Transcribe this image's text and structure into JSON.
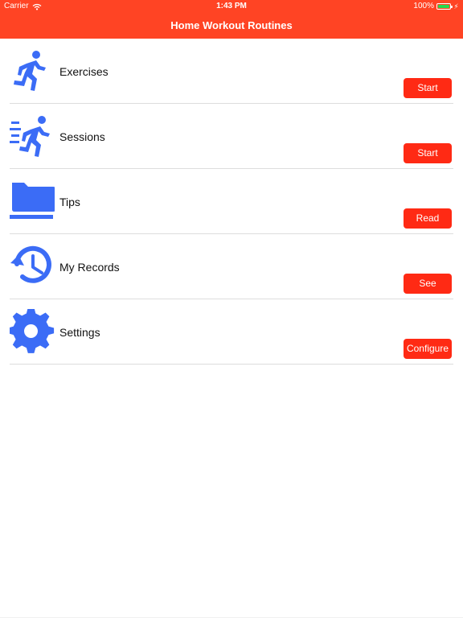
{
  "status_bar": {
    "carrier": "Carrier",
    "time": "1:43 PM",
    "battery_percent": "100%",
    "battery_level": 1.0
  },
  "navbar": {
    "title": "Home Workout Routines"
  },
  "colors": {
    "accent": "#ff4424",
    "button": "#ff2a14",
    "icon": "#3b6cf6"
  },
  "menu": {
    "items": [
      {
        "label": "Exercises",
        "button": "Start",
        "icon": "running-person-icon"
      },
      {
        "label": "Sessions",
        "button": "Start",
        "icon": "fast-running-person-icon"
      },
      {
        "label": "Tips",
        "button": "Read",
        "icon": "folder-stack-icon"
      },
      {
        "label": "My Records",
        "button": "See",
        "icon": "history-clock-icon"
      },
      {
        "label": "Settings",
        "button": "Configure",
        "icon": "gear-icon"
      }
    ]
  }
}
